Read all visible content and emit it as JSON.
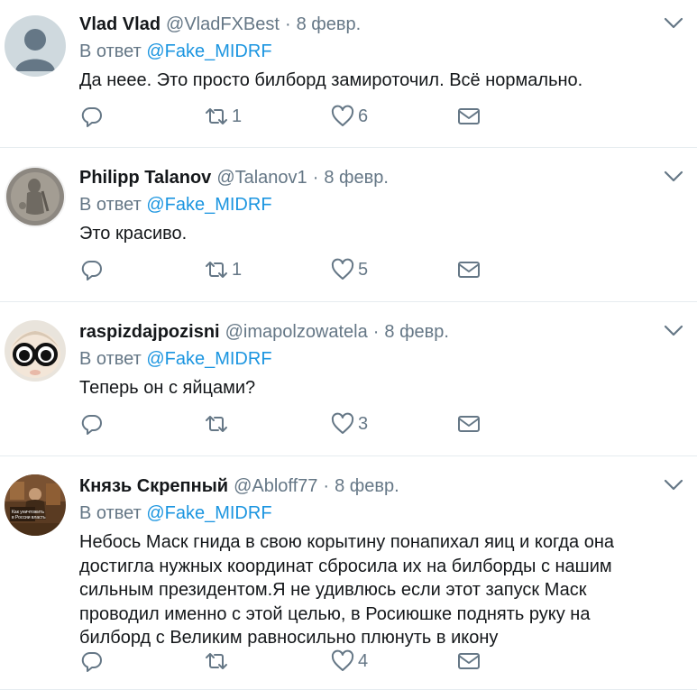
{
  "tweets": [
    {
      "name": "Vlad Vlad",
      "handle": "@VladFXBest",
      "dot": "·",
      "time": "8 февр.",
      "reply_prefix": "В ответ",
      "mention": "@Fake_MIDRF",
      "text": "Да неее. Это просто билборд замироточил. Всё нормально.",
      "retweets": "1",
      "likes": "6",
      "avatar_icon": "default-avatar-icon"
    },
    {
      "name": "Philipp Talanov",
      "handle": "@Talanov1",
      "dot": "·",
      "time": "8 февр.",
      "reply_prefix": "В ответ",
      "mention": "@Fake_MIDRF",
      "text": "Это красиво.",
      "retweets": "1",
      "likes": "5",
      "avatar_icon": "ancient-coin-avatar-icon"
    },
    {
      "name": "raspizdajpozisni",
      "handle": "@imapolzowatela",
      "dot": "·",
      "time": "8 февр.",
      "reply_prefix": "В ответ",
      "mention": "@Fake_MIDRF",
      "text": "Теперь он с яйцами?",
      "retweets": "",
      "likes": "3",
      "avatar_icon": "glasses-character-avatar-icon"
    },
    {
      "name": "Князь Скрепный",
      "handle": "@Abloff77",
      "dot": "·",
      "time": "8 февр.",
      "reply_prefix": "В ответ",
      "mention": "@Fake_MIDRF",
      "text": "Небось Маск гнида в свою корытину понапихал яиц и когда она достигла нужных координат сбросила их на билборды с нашим сильным президентом.Я не удивлюсь если этот запуск Маск проводил именно с этой целью,  в Росиюшке поднять руку на билборд с Великим равносильно плюнуть в икону",
      "retweets": "",
      "likes": "4",
      "avatar_icon": "photo-avatar-icon"
    }
  ],
  "colors": {
    "text": "#14171a",
    "secondary": "#657786",
    "link": "#1b95e0",
    "divider": "#e6ecf0"
  }
}
